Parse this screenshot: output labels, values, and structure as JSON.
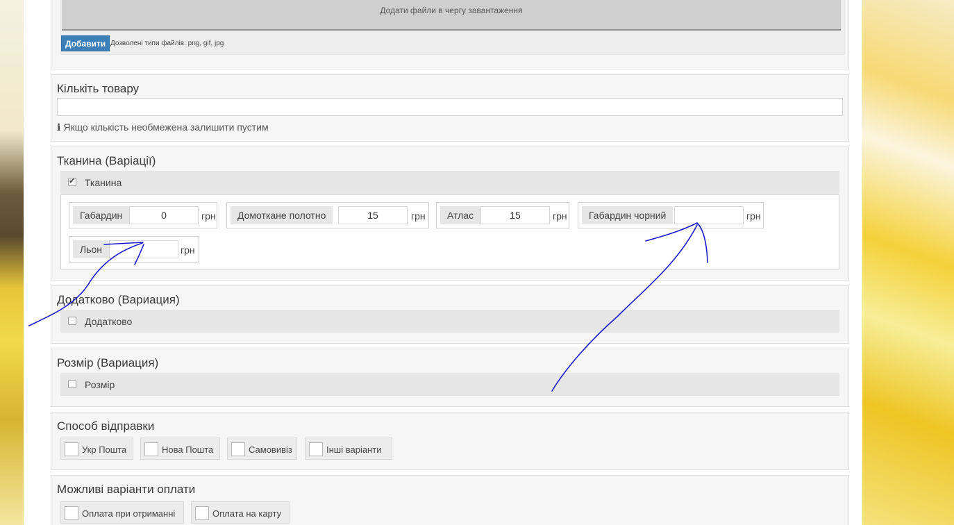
{
  "upload": {
    "dropzone_text": "Додати файли в чергу завантаження",
    "add_button": "Добавити",
    "allowed_types": "Дозволені типи файлів: png, gif, jpg"
  },
  "quantity": {
    "title": "Кількіть товару",
    "value": "",
    "hint_icon": "i",
    "hint": "Якщо кількість необмежена залишити пустим"
  },
  "fabric": {
    "title": "Тканина (Варіації)",
    "checkbox_label": "Тканина",
    "checked": true,
    "currency": "грн",
    "items": [
      {
        "name": "Габардин",
        "value": "0"
      },
      {
        "name": "Домоткане полотно",
        "value": "15"
      },
      {
        "name": "Атлас",
        "value": "15"
      },
      {
        "name": "Габардин чорний",
        "value": ""
      },
      {
        "name": "Льон",
        "value": ""
      }
    ]
  },
  "extra": {
    "title": "Додатково (Вариация)",
    "checkbox_label": "Додатково",
    "checked": false
  },
  "size": {
    "title": "Розмір (Вариация)",
    "checkbox_label": "Розмір",
    "checked": false
  },
  "shipping": {
    "title": "Способ відправки",
    "options": [
      "Укр Пошта",
      "Нова Пошта",
      "Самовивіз",
      "Інші варіанти"
    ]
  },
  "payment": {
    "title": "Можливі варіанти оплати",
    "options": [
      "Оплата при отриманні",
      "Оплата на карту"
    ]
  },
  "colors": {
    "button": "#3c7fb9",
    "annotation_ink": "#1a1acc",
    "panel_bg": "#f6f6f6"
  }
}
